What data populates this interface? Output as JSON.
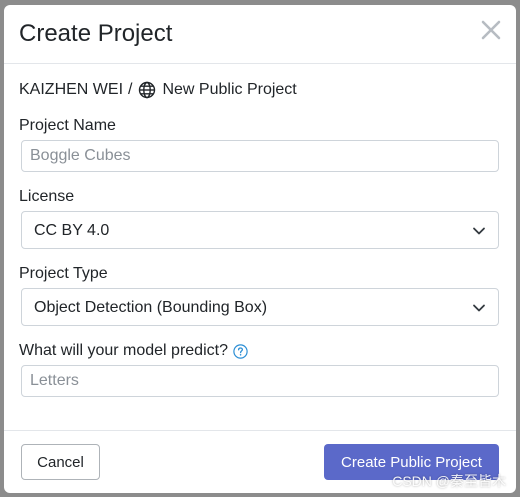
{
  "dialog": {
    "title": "Create Project"
  },
  "breadcrumb": {
    "owner": "KAIZHEN WEI",
    "separator": "/",
    "project": "New Public Project"
  },
  "fields": {
    "project_name": {
      "label": "Project Name",
      "value": "",
      "placeholder": "Boggle Cubes"
    },
    "license": {
      "label": "License",
      "value": "CC BY 4.0"
    },
    "project_type": {
      "label": "Project Type",
      "value": "Object Detection (Bounding Box)"
    },
    "predict": {
      "label": "What will your model predict?",
      "value": "",
      "placeholder": "Letters"
    }
  },
  "footer": {
    "cancel_label": "Cancel",
    "create_label": "Create Public Project"
  },
  "watermark": "CSDN @秦至皆木",
  "colors": {
    "primary": "#5b69c9",
    "help_icon": "#2d8fd5",
    "border": "#ced4da"
  },
  "icons": [
    "close-icon",
    "globe-icon",
    "help-icon",
    "chevron-down-icon"
  ]
}
